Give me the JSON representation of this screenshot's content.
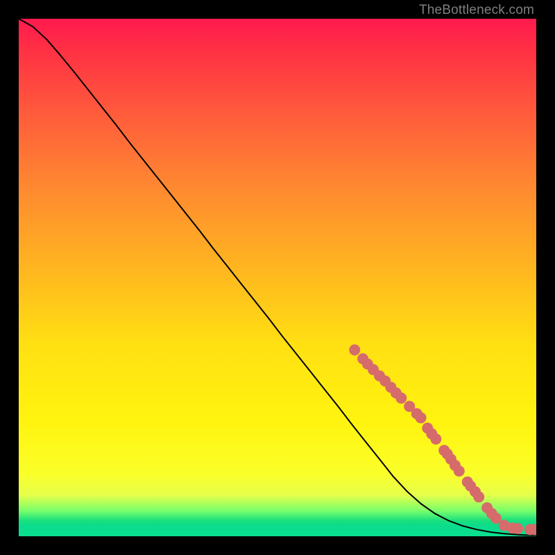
{
  "attribution": "TheBottleneck.com",
  "chart_data": {
    "type": "line",
    "title": "",
    "xlabel": "",
    "ylabel": "",
    "xlim": [
      0,
      100
    ],
    "ylim": [
      0,
      100
    ],
    "series": [
      {
        "name": "curve",
        "x": [
          0.0,
          2.7,
          5.4,
          8.0,
          10.7,
          13.4,
          16.1,
          18.8,
          21.4,
          24.1,
          26.8,
          29.5,
          32.2,
          34.9,
          37.5,
          40.2,
          42.9,
          45.6,
          48.3,
          50.9,
          53.6,
          56.3,
          59.0,
          61.7,
          64.3,
          67.0,
          69.7,
          72.4,
          75.1,
          77.7,
          80.4,
          83.1,
          85.8,
          88.5,
          91.2,
          93.8,
          96.5,
          98.5,
          100.0
        ],
        "y": [
          100.0,
          98.5,
          96.0,
          93.0,
          89.7,
          86.3,
          82.9,
          79.5,
          76.1,
          72.7,
          69.3,
          65.9,
          62.5,
          59.1,
          55.7,
          52.3,
          48.9,
          45.5,
          42.1,
          38.7,
          35.3,
          31.9,
          28.5,
          25.1,
          21.7,
          18.3,
          14.9,
          11.5,
          8.6,
          6.3,
          4.4,
          3.0,
          2.0,
          1.3,
          0.8,
          0.5,
          0.3,
          0.2,
          0.2
        ]
      }
    ],
    "markers": [
      {
        "x": 64.9,
        "y": 36.0
      },
      {
        "x": 66.5,
        "y": 34.3
      },
      {
        "x": 67.4,
        "y": 33.3
      },
      {
        "x": 68.5,
        "y": 32.2
      },
      {
        "x": 69.7,
        "y": 31.0
      },
      {
        "x": 70.8,
        "y": 30.0
      },
      {
        "x": 71.9,
        "y": 28.8
      },
      {
        "x": 72.9,
        "y": 27.7
      },
      {
        "x": 73.9,
        "y": 26.7
      },
      {
        "x": 75.5,
        "y": 25.1
      },
      {
        "x": 76.9,
        "y": 23.7
      },
      {
        "x": 77.7,
        "y": 22.9
      },
      {
        "x": 79.0,
        "y": 20.9
      },
      {
        "x": 79.8,
        "y": 19.8
      },
      {
        "x": 80.6,
        "y": 18.8
      },
      {
        "x": 82.2,
        "y": 16.6
      },
      {
        "x": 82.8,
        "y": 15.9
      },
      {
        "x": 83.5,
        "y": 14.9
      },
      {
        "x": 84.3,
        "y": 13.7
      },
      {
        "x": 85.1,
        "y": 12.6
      },
      {
        "x": 86.7,
        "y": 10.5
      },
      {
        "x": 87.3,
        "y": 9.7
      },
      {
        "x": 88.2,
        "y": 8.6
      },
      {
        "x": 88.9,
        "y": 7.6
      },
      {
        "x": 90.5,
        "y": 5.5
      },
      {
        "x": 91.4,
        "y": 4.4
      },
      {
        "x": 92.2,
        "y": 3.5
      },
      {
        "x": 93.8,
        "y": 2.1
      },
      {
        "x": 95.4,
        "y": 1.6
      },
      {
        "x": 96.4,
        "y": 1.5
      },
      {
        "x": 98.8,
        "y": 1.3
      },
      {
        "x": 99.7,
        "y": 1.3
      }
    ],
    "marker_color": "#d66b6b",
    "marker_radius_px": 8,
    "line_color": "#000000"
  }
}
